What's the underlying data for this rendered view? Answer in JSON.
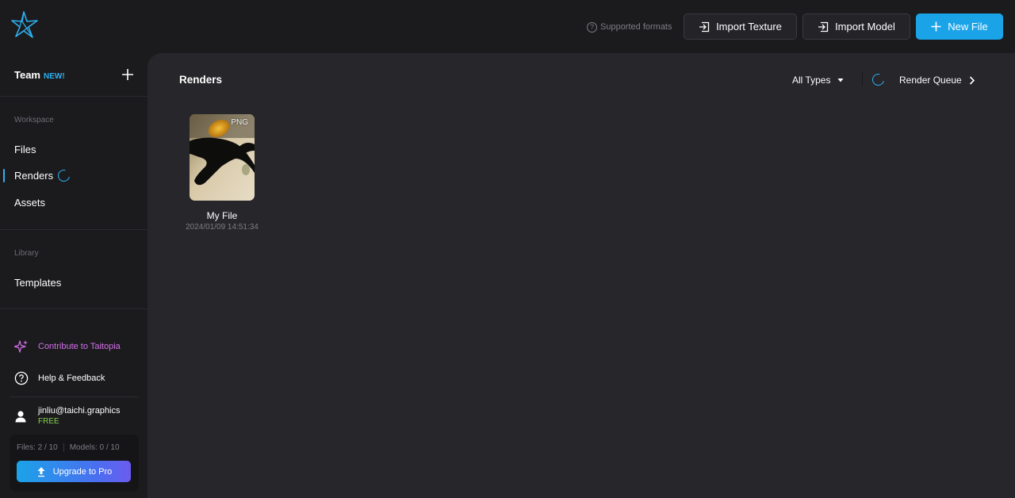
{
  "header": {
    "supported_formats": "Supported formats",
    "import_texture": "Import Texture",
    "import_model": "Import Model",
    "new_file": "New File"
  },
  "sidebar": {
    "team_label": "Team",
    "team_badge": "NEW!",
    "workspace_label": "Workspace",
    "workspace_items": [
      {
        "label": "Files",
        "active": false
      },
      {
        "label": "Renders",
        "active": true
      },
      {
        "label": "Assets",
        "active": false
      }
    ],
    "library_label": "Library",
    "library_items": [
      {
        "label": "Templates"
      }
    ],
    "contribute": "Contribute to Taitopia",
    "help": "Help & Feedback",
    "user_email": "jinliu@taichi.graphics",
    "user_plan": "FREE",
    "files_quota": "Files: 2 / 10",
    "models_quota": "Models: 0 / 10",
    "upgrade": "Upgrade to Pro"
  },
  "main": {
    "title": "Renders",
    "filter": "All Types",
    "render_queue": "Render Queue",
    "items": [
      {
        "name": "My File",
        "date": "2024/01/09 14:51:34",
        "format": "PNG"
      }
    ]
  },
  "colors": {
    "accent": "#1ba3e8",
    "contribute": "#d56fe9",
    "plan": "#86d34b",
    "main_bg": "#26262b",
    "sidebar_bg": "#1b1b1e"
  }
}
